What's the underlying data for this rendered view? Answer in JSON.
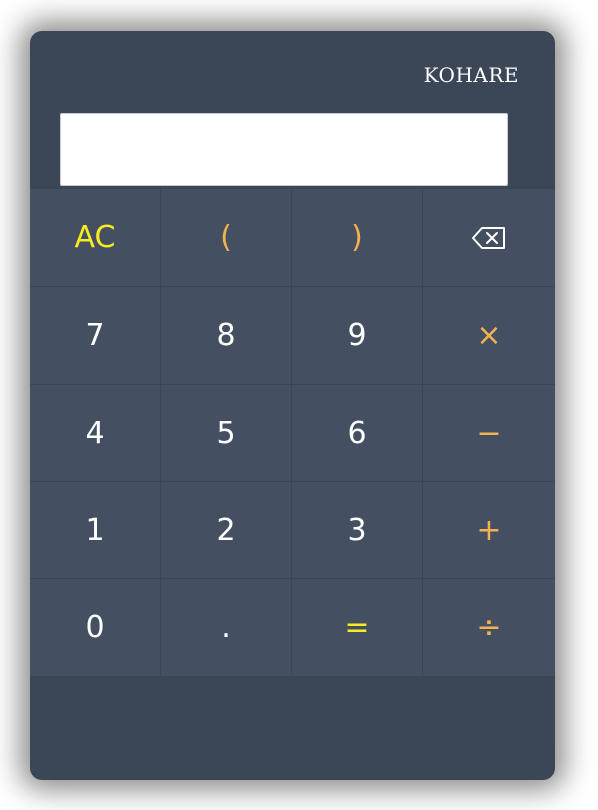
{
  "brand": "KOHARE",
  "display": {
    "value": "",
    "placeholder": ""
  },
  "keys": [
    {
      "label": "AC",
      "name": "clear-button",
      "color": "#f7ec1e"
    },
    {
      "label": "(",
      "name": "open-paren-button",
      "color": "#f5b04f"
    },
    {
      "label": ")",
      "name": "close-paren-button",
      "color": "#f5b04f"
    },
    {
      "label": "",
      "name": "backspace-button",
      "icon": "backspace-icon",
      "color": "#ffffff"
    },
    {
      "label": "7",
      "name": "digit-7-button",
      "color": "#ffffff"
    },
    {
      "label": "8",
      "name": "digit-8-button",
      "color": "#ffffff"
    },
    {
      "label": "9",
      "name": "digit-9-button",
      "color": "#ffffff"
    },
    {
      "label": "×",
      "name": "multiply-button",
      "color": "#f5b04f"
    },
    {
      "label": "4",
      "name": "digit-4-button",
      "color": "#ffffff"
    },
    {
      "label": "5",
      "name": "digit-5-button",
      "color": "#ffffff"
    },
    {
      "label": "6",
      "name": "digit-6-button",
      "color": "#ffffff"
    },
    {
      "label": "−",
      "name": "subtract-button",
      "color": "#f5b04f"
    },
    {
      "label": "1",
      "name": "digit-1-button",
      "color": "#ffffff"
    },
    {
      "label": "2",
      "name": "digit-2-button",
      "color": "#ffffff"
    },
    {
      "label": "3",
      "name": "digit-3-button",
      "color": "#ffffff"
    },
    {
      "label": "+",
      "name": "add-button",
      "color": "#f5b04f"
    },
    {
      "label": "0",
      "name": "digit-0-button",
      "color": "#ffffff"
    },
    {
      "label": ".",
      "name": "decimal-button",
      "color": "#ffffff"
    },
    {
      "label": "=",
      "name": "equals-button",
      "color": "#f7ec1e"
    },
    {
      "label": "÷",
      "name": "divide-button",
      "color": "#f5b04f"
    }
  ],
  "colors": {
    "body": "#3b4657",
    "keypad": "#445061",
    "accent_yellow": "#f7ec1e",
    "accent_orange": "#f5b04f"
  }
}
